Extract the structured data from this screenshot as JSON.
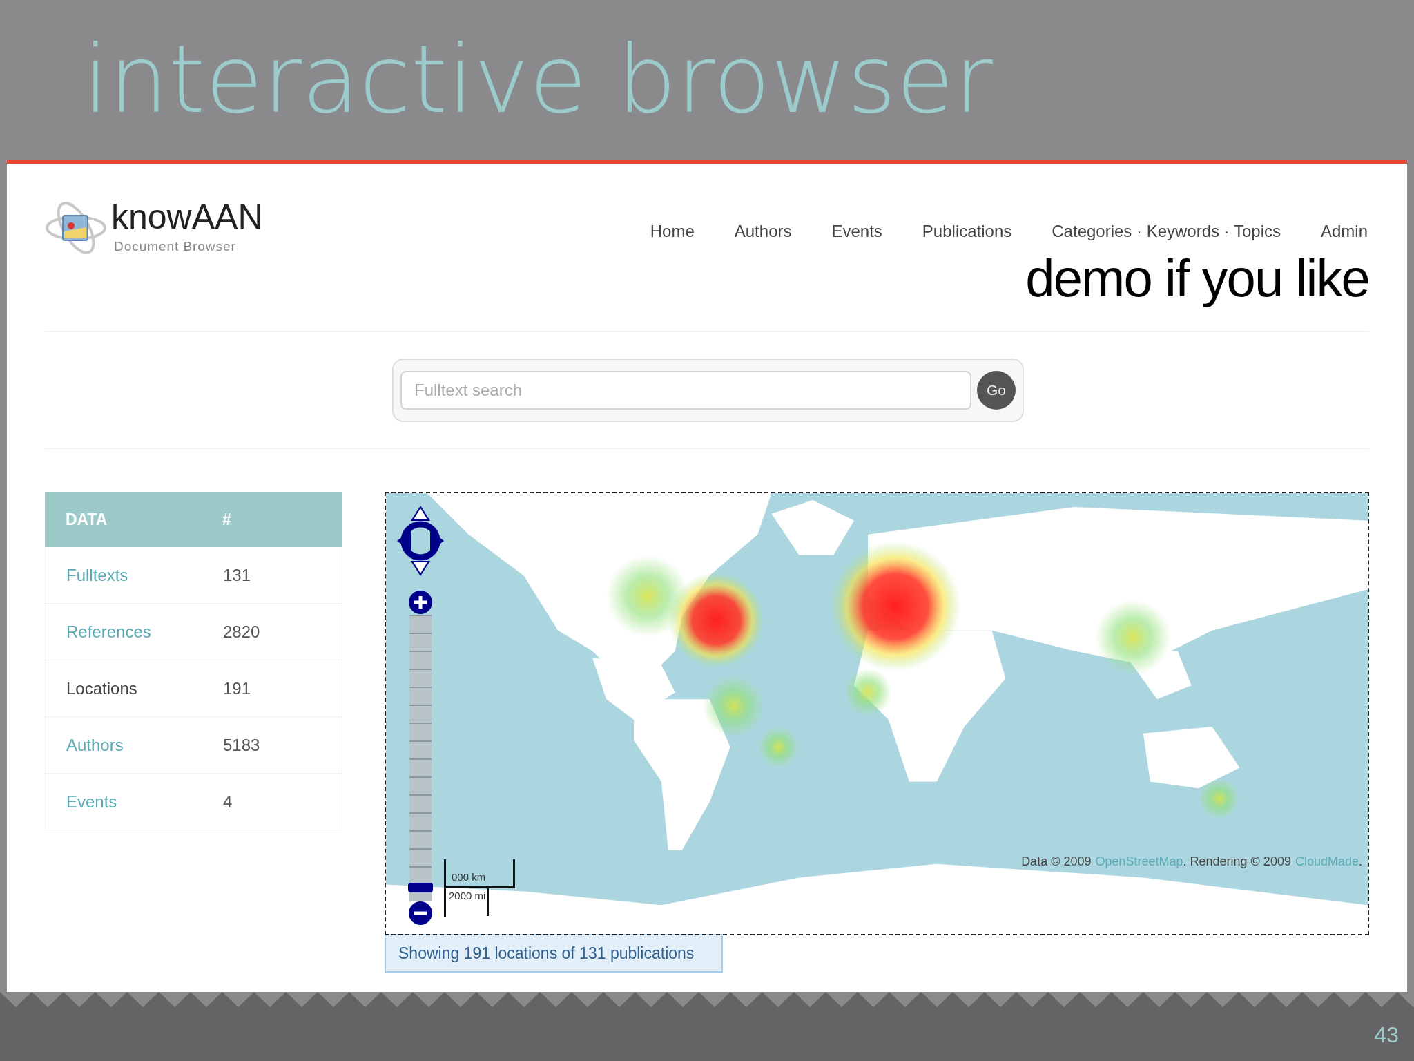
{
  "slide": {
    "title": "interactive browser",
    "note": "demo if you like",
    "page_number": "43"
  },
  "app": {
    "logo": {
      "name": "knowAAN",
      "subtitle": "Document Browser"
    },
    "nav": [
      {
        "label": "Home"
      },
      {
        "label": "Authors"
      },
      {
        "label": "Events"
      },
      {
        "label": "Publications"
      },
      {
        "label": "Categories · Keywords · Topics"
      },
      {
        "label": "Admin"
      }
    ],
    "search": {
      "placeholder": "Fulltext search",
      "button": "Go"
    },
    "table": {
      "columns": [
        "DATA",
        "#"
      ],
      "rows": [
        {
          "label": "Fulltexts",
          "count": "131",
          "kind": "link"
        },
        {
          "label": "References",
          "count": "2820",
          "kind": "link"
        },
        {
          "label": "Locations",
          "count": "191",
          "kind": "text"
        },
        {
          "label": "Authors",
          "count": "5183",
          "kind": "link"
        },
        {
          "label": "Events",
          "count": "4",
          "kind": "link"
        }
      ]
    },
    "map": {
      "zoom": {
        "level": 0.03
      },
      "scale": {
        "km": "000 km",
        "mi": "2000 mi"
      },
      "attribution": [
        {
          "text": "Data © 2009",
          "kind": "text"
        },
        {
          "text": "OpenStreetMap",
          "kind": "link"
        },
        {
          "text": ". Rendering © 2009",
          "kind": "text"
        },
        {
          "text": "CloudMade",
          "kind": "link"
        },
        {
          "text": ".",
          "kind": "text"
        }
      ]
    },
    "caption": "Showing 191 locations of 131 publications"
  }
}
